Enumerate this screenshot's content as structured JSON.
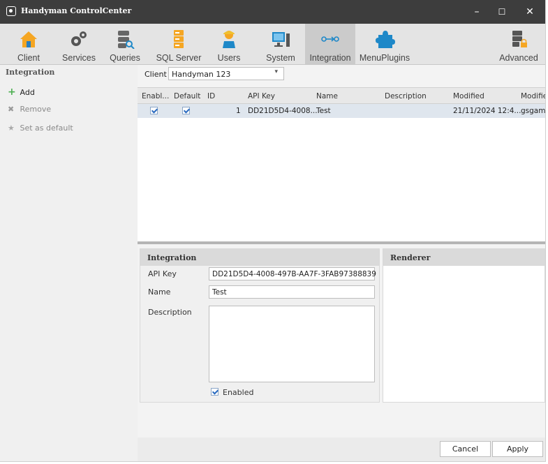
{
  "window": {
    "title": "Handyman ControlCenter",
    "minimize_glyph": "–",
    "maximize_glyph": "☐",
    "close_glyph": "✕"
  },
  "ribbon": {
    "items": [
      {
        "label": "Client",
        "icon": "house-icon"
      },
      {
        "label": "Services",
        "icon": "gears-icon"
      },
      {
        "label": "Queries",
        "icon": "database-search-icon"
      },
      {
        "label": "SQL Server",
        "icon": "server-stack-icon"
      },
      {
        "label": "Users",
        "icon": "user-icon"
      },
      {
        "label": "System",
        "icon": "computer-icon"
      },
      {
        "label": "Integration",
        "icon": "integration-arrow-icon"
      },
      {
        "label": "MenuPlugins",
        "icon": "puzzle-icon"
      },
      {
        "label": "Advanced",
        "icon": "server-lock-icon"
      }
    ],
    "active": "Integration"
  },
  "sidebar": {
    "header": "Integration",
    "items": [
      {
        "label": "Add",
        "icon": "plus-icon",
        "glyph": "+",
        "enabled": true
      },
      {
        "label": "Remove",
        "icon": "x-icon",
        "glyph": "✖",
        "enabled": false
      },
      {
        "label": "Set as default",
        "icon": "star-icon",
        "glyph": "★",
        "enabled": false
      }
    ]
  },
  "client": {
    "label": "Client",
    "value": "Handyman 123",
    "arrow": "▾"
  },
  "grid": {
    "columns": [
      "Enabl...",
      "Default",
      "ID",
      "API Key",
      "Name",
      "Description",
      "Modified",
      "Modifie"
    ],
    "rows": [
      {
        "enabled": true,
        "default": true,
        "id": "1",
        "api_key": "DD21D5D4-4008...",
        "name": "Test",
        "description": "",
        "modified": "21/11/2024 12:4...",
        "modified_by": "gsgama"
      }
    ]
  },
  "integration_panel": {
    "title": "Integration",
    "api_key_label": "API Key",
    "api_key_value": "DD21D5D4-4008-497B-AA7F-3FAB97388839",
    "name_label": "Name",
    "name_value": "Test",
    "description_label": "Description",
    "description_value": "",
    "enabled_label": "Enabled",
    "enabled": true
  },
  "renderer_panel": {
    "title": "Renderer"
  },
  "footer": {
    "cancel_label": "Cancel",
    "apply_label": "Apply"
  },
  "colors": {
    "titlebar": "#3d3d3d",
    "ribbon": "#e4e4e4",
    "selected_row": "#dfe6ee",
    "accent_orange": "#f5a623",
    "accent_blue": "#1e88c8"
  }
}
